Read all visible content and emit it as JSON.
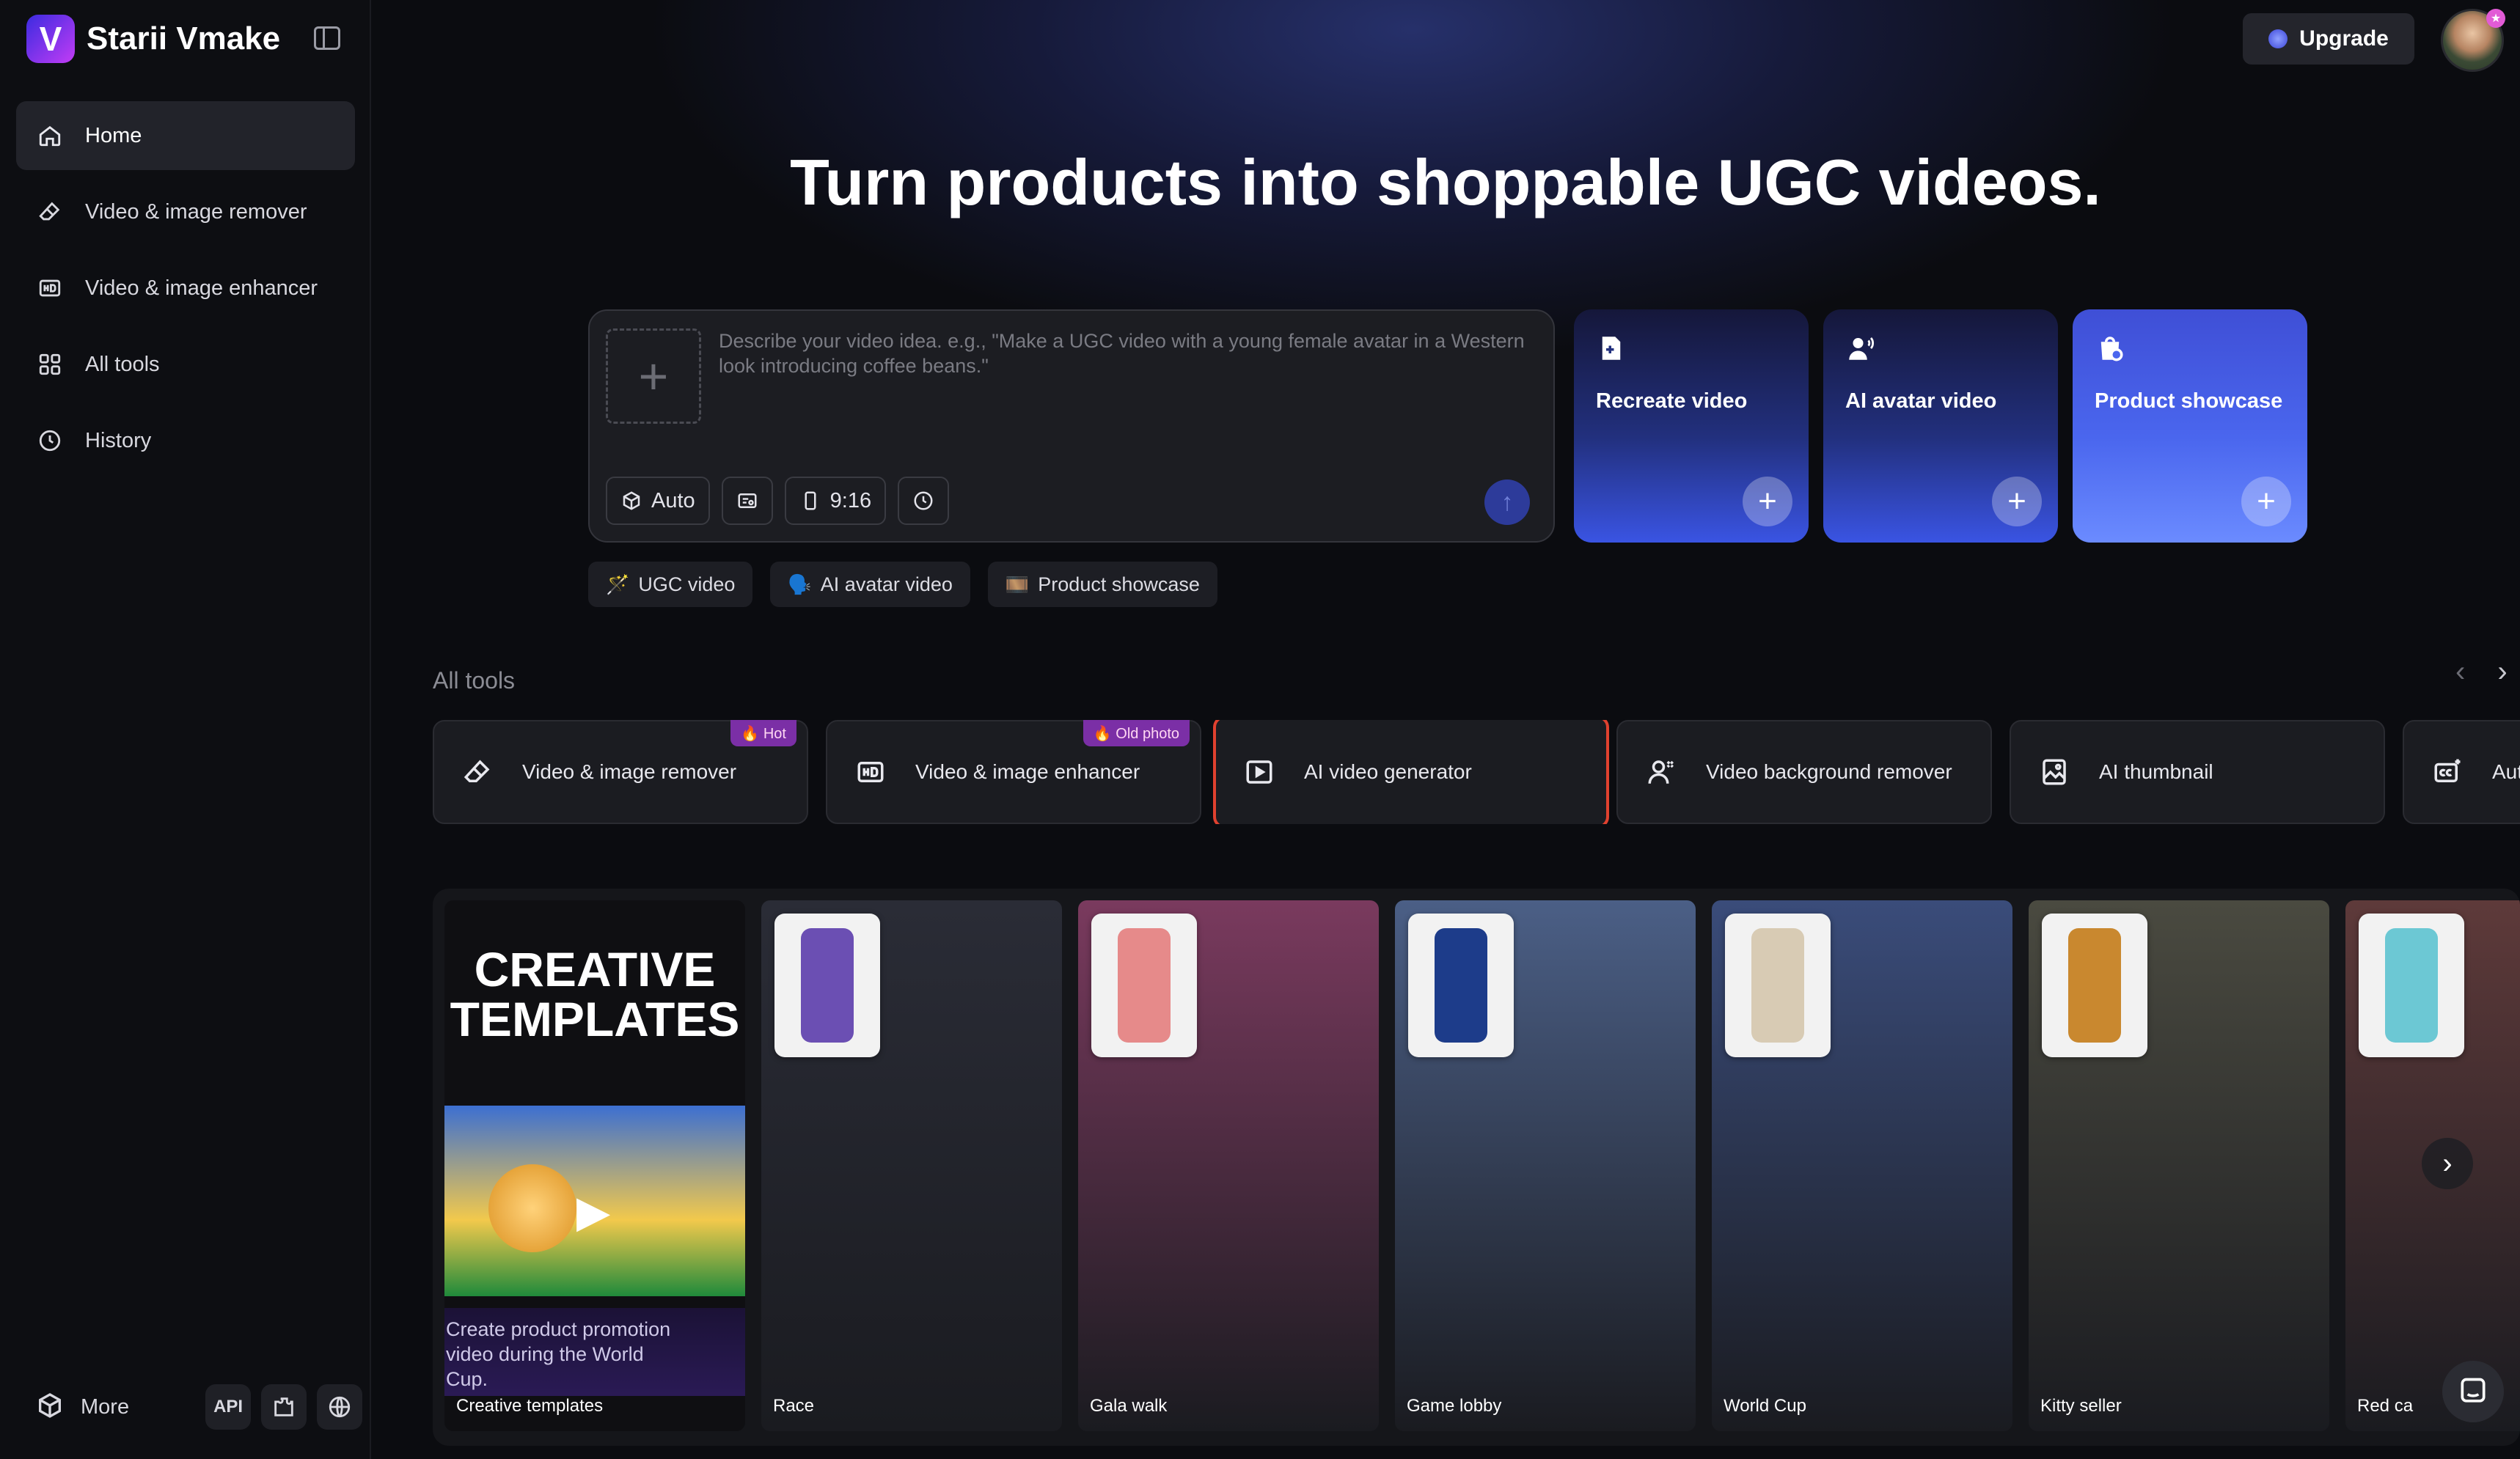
{
  "app": {
    "name": "Starii Vmake",
    "logo_letter": "V"
  },
  "sidebar": {
    "items": [
      {
        "label": "Home",
        "icon": "home-icon",
        "active": true
      },
      {
        "label": "Video & image remover",
        "icon": "eraser-icon"
      },
      {
        "label": "Video & image enhancer",
        "icon": "hd-icon"
      },
      {
        "label": "All tools",
        "icon": "grid-icon"
      },
      {
        "label": "History",
        "icon": "clock-icon"
      }
    ],
    "more_label": "More",
    "api_label": "API"
  },
  "header": {
    "upgrade_label": "Upgrade",
    "avatar_badge": "★"
  },
  "hero": {
    "title": "Turn products into shoppable UGC videos."
  },
  "prompt": {
    "placeholder": "Describe your video idea. e.g., \"Make a UGC video with a young female avatar in a Western look introducing coffee beans.\"",
    "model_label": "Auto",
    "ratio_label": "9:16"
  },
  "feature_cards": [
    {
      "label": "Recreate video",
      "icon": "recreate-icon"
    },
    {
      "label": "AI avatar video",
      "icon": "avatar-icon"
    },
    {
      "label": "Product showcase",
      "icon": "product-icon"
    }
  ],
  "chips": [
    {
      "emoji": "🪄",
      "label": "UGC video"
    },
    {
      "emoji": "🗣️",
      "label": "AI avatar video"
    },
    {
      "emoji": "🎞️",
      "label": "Product showcase"
    }
  ],
  "tools": {
    "section_label": "All tools",
    "items": [
      {
        "label": "Video & image remover",
        "badge": "🔥 Hot",
        "icon": "eraser-icon"
      },
      {
        "label": "Video & image enhancer",
        "badge": "🔥 Old photo",
        "icon": "hd-icon"
      },
      {
        "label": "AI video generator",
        "badge": "",
        "icon": "play-icon",
        "selected": true
      },
      {
        "label": "Video background remover",
        "badge": "",
        "icon": "person-cutout-icon"
      },
      {
        "label": "AI thumbnail",
        "badge": "",
        "icon": "thumbnail-icon"
      },
      {
        "label": "Aut",
        "badge": "",
        "icon": "cc-icon"
      }
    ]
  },
  "gallery": {
    "creative": {
      "title_line1": "CREATIVE",
      "title_line2": "TEMPLATES",
      "description": "Create product promotion video during the World Cup.",
      "caption": "Creative templates"
    },
    "cards": [
      {
        "caption": "Race",
        "bg": "#2a2c36",
        "product": "#6b4fb3"
      },
      {
        "caption": "Gala walk",
        "bg": "#7a3a5e",
        "product": "#e68a8a"
      },
      {
        "caption": "Game lobby",
        "bg": "#4b5f86",
        "product": "#1d3c8a"
      },
      {
        "caption": "World Cup",
        "bg": "#3a4c7a",
        "product": "#d8cbb4"
      },
      {
        "caption": "Kitty seller",
        "bg": "#4a4a40",
        "product": "#c9882f"
      },
      {
        "caption": "Red ca",
        "bg": "#5e3a3a",
        "product": "#6cc8d4"
      }
    ]
  }
}
